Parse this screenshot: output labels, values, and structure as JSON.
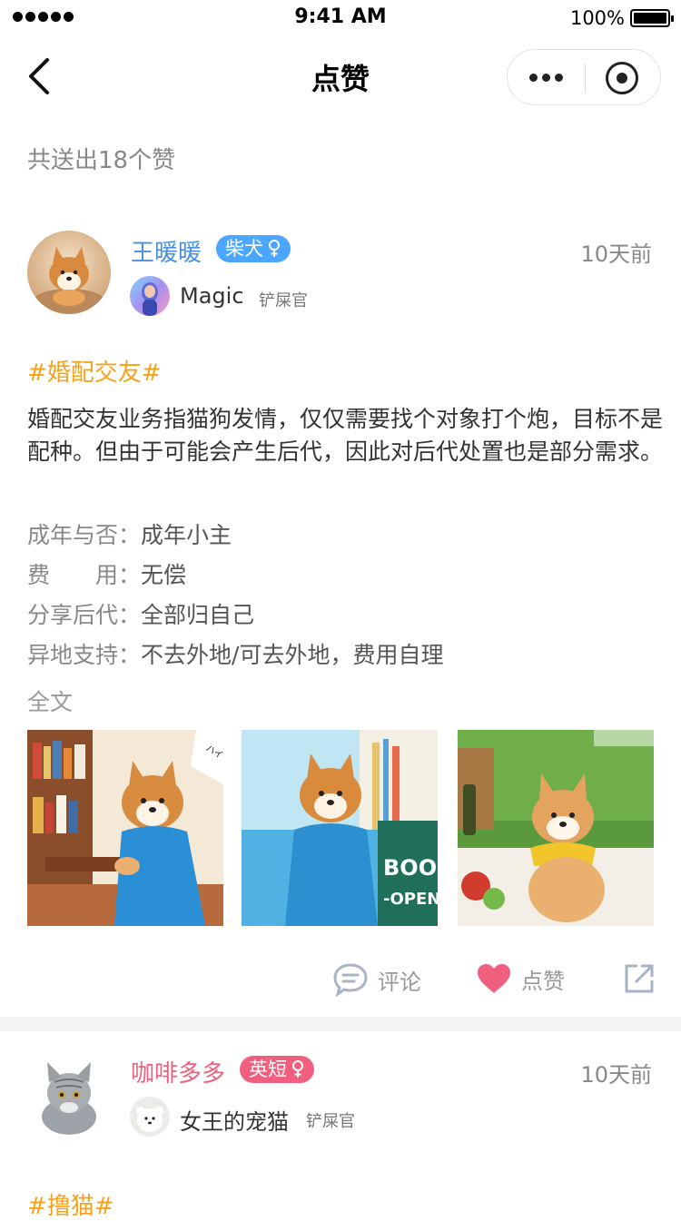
{
  "status_bar": {
    "time": "9:41 AM",
    "battery": "100%"
  },
  "nav": {
    "title": "点赞"
  },
  "summary": "共送出18个赞",
  "posts": [
    {
      "username": "王暖暖",
      "breed": "柴犬",
      "time": "10天前",
      "owner_name": "Magic",
      "owner_role": "铲屎官",
      "tag": "#婚配交友#",
      "body": "婚配交友业务指猫狗发情，仅仅需要找个对象打个炮，目标不是配种。但由于可能会产生后代，因此对后代处置也是部分需求。",
      "info": [
        {
          "label": "成年与否：",
          "value": "成年小主"
        },
        {
          "label": "费　　用：",
          "value": "无偿"
        },
        {
          "label": "分享后代：",
          "value": "全部归自己"
        },
        {
          "label": "异地支持：",
          "value": "不去外地/可去外地，费用自理"
        }
      ],
      "fulltext": "全文",
      "actions": {
        "comment": "评论",
        "like": "点赞"
      }
    },
    {
      "username": "咖啡多多",
      "breed": "英短",
      "time": "10天前",
      "owner_name": "女王的宠猫",
      "owner_role": "铲屎官",
      "tag": "#撸猫#"
    }
  ],
  "colors": {
    "accent_blue": "#4aa6ff",
    "accent_pink": "#f0607e",
    "tag_orange": "#f7a21b",
    "like_red": "#f0607e"
  }
}
